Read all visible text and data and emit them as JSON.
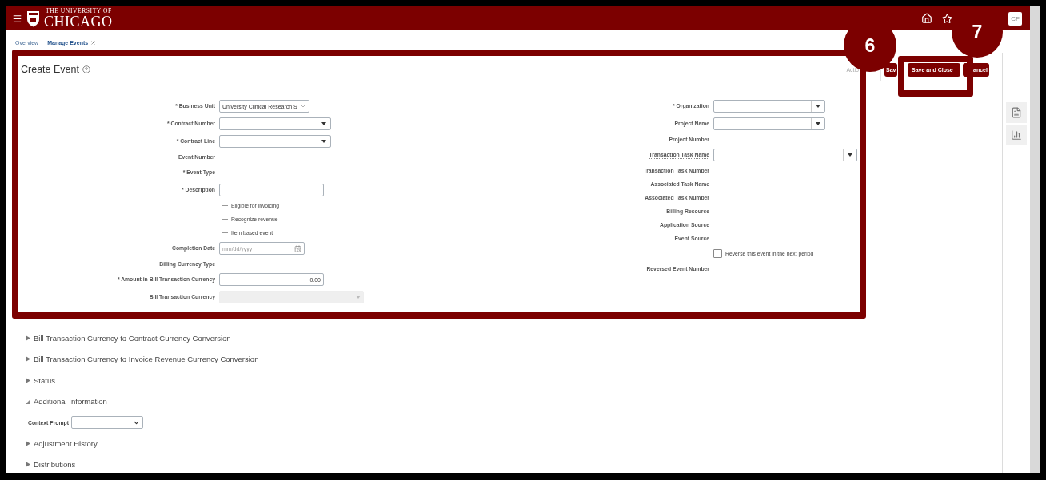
{
  "header": {
    "logo_top": "THE UNIVERSITY OF",
    "logo_bottom": "CHICAGO",
    "avatar": "CF"
  },
  "breadcrumbs": [
    {
      "label": "Overview",
      "selected": false
    },
    {
      "label": "Manage Events",
      "selected": true
    }
  ],
  "page": {
    "title": "Create Event",
    "actions_menu": "Actio",
    "buttons": [
      "Sav",
      "Save and Close",
      "ancel"
    ]
  },
  "form": {
    "left_fields": [
      {
        "label": "* Business Unit",
        "kind": "select",
        "value": "University Clinical Research S"
      },
      {
        "label": "* Contract Number",
        "kind": "combo"
      },
      {
        "label": "* Contract Line",
        "kind": "combo"
      },
      {
        "label": "Event Number",
        "kind": "label"
      },
      {
        "label": "* Event Type",
        "kind": "tall-label"
      },
      {
        "label": "* Description",
        "kind": "input"
      },
      {
        "label": "Eligible for invoicing",
        "kind": "flag",
        "checked": false
      },
      {
        "label": "Recognize revenue",
        "kind": "flag",
        "checked": false
      },
      {
        "label": "Item based event",
        "kind": "flag",
        "checked": false
      },
      {
        "label": "Completion Date",
        "kind": "date",
        "placeholder": "mm/dd/yyyy"
      },
      {
        "label": "Billing Currency Type",
        "kind": "label"
      },
      {
        "label": "* Amount in Bill Transaction Currency",
        "kind": "input",
        "value": "0.00"
      },
      {
        "label": "Bill Transaction Currency",
        "kind": "disabled-select"
      }
    ],
    "right_fields": [
      {
        "label": "* Organization",
        "kind": "combo",
        "help_note": false
      },
      {
        "label": "Project Name",
        "kind": "combo",
        "help_note": false
      },
      {
        "label": "Project Number",
        "kind": "label",
        "help_note": false
      },
      {
        "label": "Transaction Task Name",
        "kind": "combo-wide",
        "help_note": true
      },
      {
        "label": "Transaction Task Number",
        "kind": "label",
        "help_note": false
      },
      {
        "label": "Associated Task Name",
        "kind": "label",
        "help_note": true
      },
      {
        "label": "Associated Task Number",
        "kind": "label",
        "help_note": false
      },
      {
        "label": "Billing Resource",
        "kind": "label",
        "help_note": false
      },
      {
        "label": "Application Source",
        "kind": "label",
        "help_note": false
      },
      {
        "label": "Event Source",
        "kind": "label",
        "help_note": false
      },
      {
        "label": "Reverse this event in the next period",
        "kind": "checkbox",
        "checked": false
      },
      {
        "label": "Reversed Event Number",
        "kind": "label",
        "help_note": false
      }
    ]
  },
  "sections": [
    {
      "label": "Bill Transaction Currency to Contract Currency Conversion",
      "expanded": false
    },
    {
      "label": "Bill Transaction Currency to Invoice Revenue Currency Conversion",
      "expanded": false
    },
    {
      "label": "Status",
      "expanded": false
    },
    {
      "label": "Additional Information",
      "expanded": true,
      "fields": [
        {
          "label": "Context Prompt",
          "kind": "select"
        }
      ]
    },
    {
      "label": "Adjustment History",
      "expanded": false
    },
    {
      "label": "Distributions",
      "expanded": false
    }
  ],
  "annotations": [
    {
      "kind": "step",
      "label": "6"
    },
    {
      "kind": "step",
      "label": "7"
    }
  ]
}
